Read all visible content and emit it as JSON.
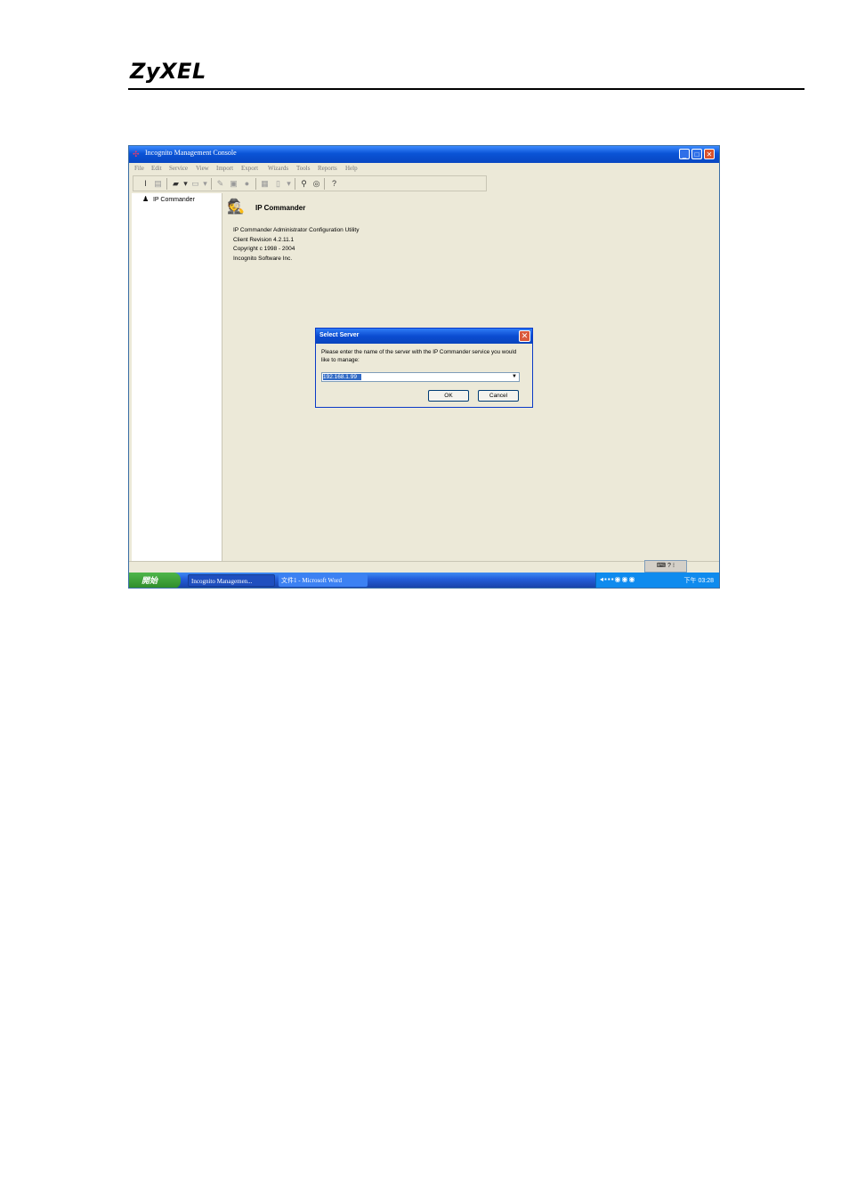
{
  "document": {
    "brand": "ZyXEL"
  },
  "window": {
    "title": "Incognito Management Console",
    "menu": [
      "File",
      "Edit",
      "Service",
      "View",
      "Import",
      "Export",
      "Wizards",
      "Tools",
      "Reports",
      "Help"
    ]
  },
  "tree": {
    "items": [
      {
        "label": "IP Commander"
      }
    ]
  },
  "content": {
    "title": "IP Commander",
    "lines": [
      "IP Commander Administrator Configuration Utility",
      "Client Revision 4.2.11.1",
      "Copyright c 1998 - 2004",
      "Incognito Software Inc."
    ]
  },
  "dialog": {
    "title": "Select Server",
    "message": "Please enter the name of the server with the IP Commander service you would like to manage:",
    "server_value": "192.168.1.99",
    "ok_label": "OK",
    "cancel_label": "Cancel"
  },
  "taskbar": {
    "start_label": "開始",
    "tasks": [
      {
        "label": "Incognito Managemen..."
      },
      {
        "label": "文件1 - Microsoft Word"
      }
    ],
    "clock": "下午 03:28"
  },
  "icons": {
    "toolbar": [
      "text-cursor-icon",
      "grid-icon",
      "open-folder-icon",
      "print-icon",
      "pencil-icon",
      "save-icon",
      "delete-icon",
      "image-icon",
      "page-icon",
      "search-icon",
      "help-circle-icon",
      "help-icon"
    ]
  },
  "colors": {
    "titlebar": "#0a53d6",
    "window_bg": "#ece9d8",
    "start_green": "#2e8c2a"
  }
}
